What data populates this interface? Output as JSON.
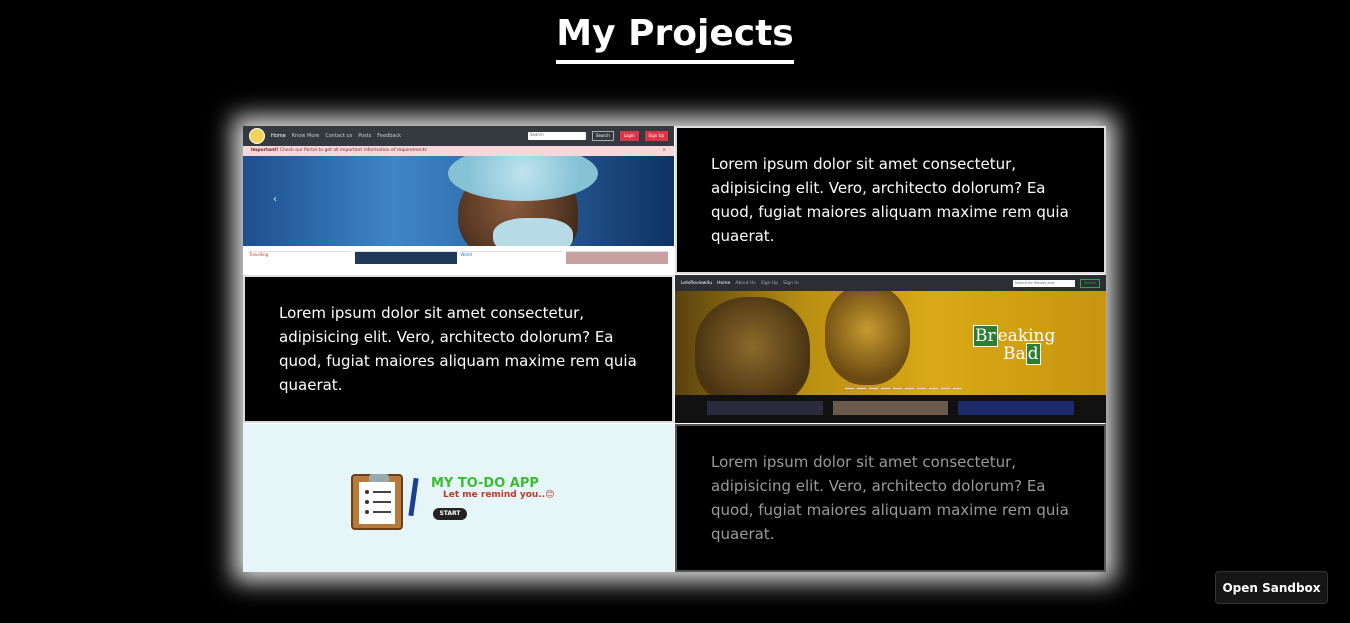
{
  "page": {
    "title": "My Projects"
  },
  "projects": [
    {
      "nav": {
        "links": [
          "Home",
          "Know More",
          "Contact us",
          "Posts",
          "Feedback"
        ],
        "search_placeholder": "Search",
        "search_button": "Search",
        "login": "Login",
        "signup": "Sign Up"
      },
      "alert": {
        "strong": "Important!",
        "text": "Check our Portal to get all important information of requirements",
        "close": "×"
      },
      "cards": [
        "Travelling",
        "World"
      ]
    },
    {
      "description": "Lorem ipsum dolor sit amet consectetur, adipisicing elit. Vero, architecto dolorum? Ea quod, fugiat maiores aliquam maxime rem quia quaerat."
    },
    {
      "description": "Lorem ipsum dolor sit amet consectetur, adipisicing elit. Vero, architecto dolorum? Ea quod, fugiat maiores aliquam maxime rem quia quaerat."
    },
    {
      "nav": {
        "brand": "LetsReview4u",
        "links": [
          "Home",
          "About Us",
          "Sign Up",
          "Sign In"
        ],
        "search_placeholder": "Search for Movies and",
        "search_button": "Search"
      },
      "hero": {
        "line1_el": "Br",
        "line1_rest": "eaking",
        "line2_start": "Ba",
        "line2_el": "d"
      }
    },
    {
      "app_title": "MY TO-DO APP",
      "app_subtitle": "Let me remind you..😊",
      "start": "START"
    },
    {
      "description": "Lorem ipsum dolor sit amet consectetur, adipisicing elit. Vero, architecto dolorum? Ea quod, fugiat maiores aliquam maxime rem quia quaerat."
    }
  ],
  "sandbox": {
    "label": "Open Sandbox"
  }
}
